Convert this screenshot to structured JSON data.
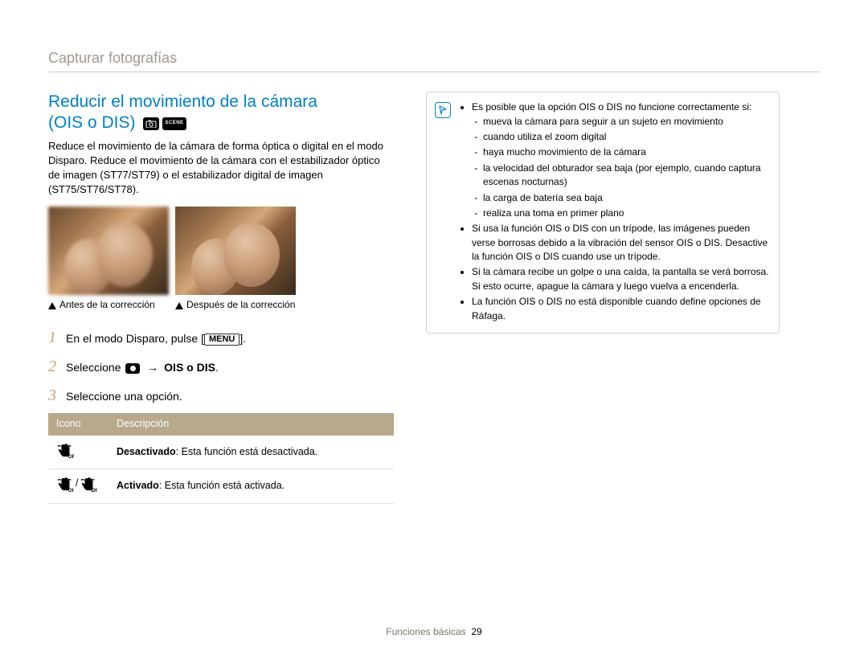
{
  "chapter_title": "Capturar fotografías",
  "section_title_line1": "Reducir el movimiento de la cámara",
  "section_title_line2": "(OIS o DIS)",
  "mode_icons": [
    "camera-p-icon",
    "scene-icon"
  ],
  "intro_text": "Reduce el movimiento de la cámara de forma óptica o digital en el modo Disparo. Reduce el movimiento de la cámara con el estabilizador óptico de imagen (ST77/ST79) o el estabilizador digital de imagen (ST75/ST76/ST78).",
  "caption_before": "Antes de la corrección",
  "caption_after": "Después de la corrección",
  "steps": {
    "s1_pre": "En el modo Disparo, pulse [",
    "s1_menu": "MENU",
    "s1_post": "].",
    "s2_pre": "Seleccione ",
    "s2_arrow": "→",
    "s2_target": "OIS o DIS",
    "s2_post": ".",
    "s3": "Seleccione una opción."
  },
  "table": {
    "h1": "Icono",
    "h2": "Descripción",
    "rows": [
      {
        "bold": "Desactivado",
        "text": ": Esta función está desactivada.",
        "icon": "hand-off-icon"
      },
      {
        "bold": "Activado",
        "text": ": Esta función está activada.",
        "icon": "hand-ois-dis-icon"
      }
    ]
  },
  "note": {
    "items": [
      {
        "text": "Es posible que la opción OIS o DIS no funcione correctamente si:",
        "sub": [
          "mueva la cámara para seguir a un sujeto en movimiento",
          "cuando utiliza el zoom digital",
          "haya mucho movimiento de la cámara",
          "la velocidad del obturador sea baja (por ejemplo, cuando captura escenas nocturnas)",
          "la carga de batería sea baja",
          "realiza una toma en primer plano"
        ]
      },
      {
        "text": "Si usa la función OIS o DIS con un trípode, las imágenes pueden verse borrosas debido a la vibración del sensor OIS o DIS. Desactive la función OIS o DIS cuando use un trípode."
      },
      {
        "text": "Si la cámara recibe un golpe o una caída, la pantalla se verá borrosa. Si esto ocurre, apague la cámara y luego vuelva a encenderla."
      },
      {
        "text": "La función OIS o DIS no está disponible cuando define opciones de Ráfaga."
      }
    ]
  },
  "footer_section": "Funciones básicas",
  "footer_page": "29"
}
